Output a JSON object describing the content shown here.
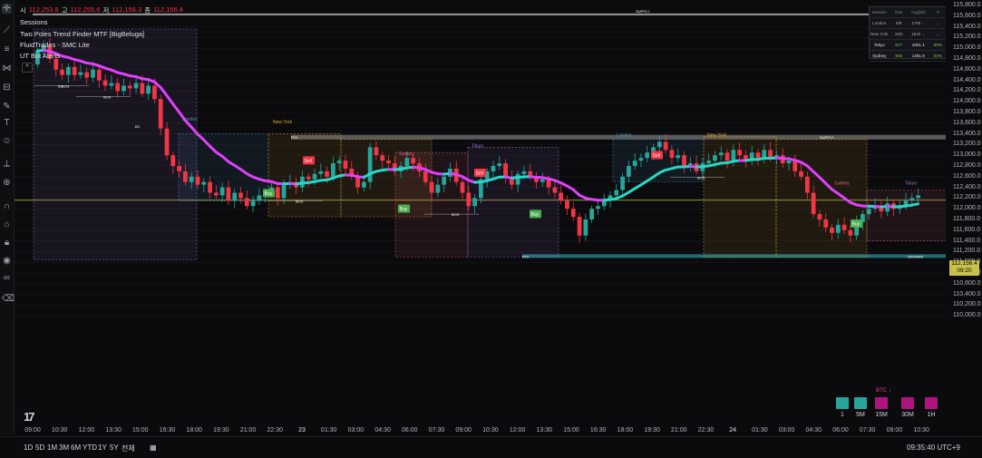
{
  "legend": {
    "ohlc": [
      {
        "k": "시",
        "v": "112,253.8"
      },
      {
        "k": "고",
        "v": "112,255.6"
      },
      {
        "k": "저",
        "v": "112,156.3"
      },
      {
        "k": "종",
        "v": "112,156.4"
      }
    ],
    "indicators": [
      "Sessions",
      "Two Poles Trend Finder MTF [BigBeluga]",
      "FluidTrades - SMC Lite",
      "UT Bot Alerts"
    ]
  },
  "session_table": {
    "header": [
      "Session",
      "Ove",
      "Avg(50)",
      "V"
    ],
    "rows": [
      [
        "London",
        "8/8",
        "1790 ...",
        "..."
      ],
      [
        "New York",
        "16/2",
        "1620 ...",
        "..."
      ],
      [
        "Tokyo",
        "577",
        "1801.1",
        "59%"
      ],
      [
        "Sydney",
        "945",
        "1481.8",
        "64%"
      ]
    ]
  },
  "price_axis": [
    "115,800.0",
    "115,600.0",
    "115,400.0",
    "115,200.0",
    "115,000.0",
    "114,800.0",
    "114,600.0",
    "114,400.0",
    "114,200.0",
    "114,000.0",
    "113,800.0",
    "113,600.0",
    "113,400.0",
    "113,200.0",
    "113,000.0",
    "112,800.0",
    "112,600.0",
    "112,400.0",
    "112,200.0",
    "112,000.0",
    "111,800.0",
    "111,600.0",
    "111,400.0",
    "111,200.0",
    "111,000.0",
    "110,800.0",
    "110,600.0",
    "110,400.0",
    "110,200.0",
    "110,000.0"
  ],
  "last_price": {
    "value": "112,156.4",
    "countdown": "09:20",
    "color": "#c8c24a"
  },
  "time_axis": [
    "09:00",
    "10:30",
    "12:00",
    "13:30",
    "15:00",
    "16:30",
    "18:00",
    "19:30",
    "21:00",
    "22:30",
    "23",
    "01:30",
    "03:00",
    "04:30",
    "06:00",
    "07:30",
    "09:00",
    "10:30",
    "12:00",
    "13:30",
    "15:00",
    "16:30",
    "18:00",
    "19:30",
    "21:00",
    "22:30",
    "24",
    "01:30",
    "03:00",
    "04:30",
    "06:00",
    "07:30",
    "09:00",
    "10:30"
  ],
  "ranges": [
    "1D",
    "5D",
    "1M",
    "3M",
    "6M",
    "YTD",
    "1Y",
    "5Y",
    "전체"
  ],
  "clock": "09:35:40 UTC+9",
  "timeframes": {
    "symbol": "BTC",
    "items": [
      {
        "label": "1",
        "color": "#26a69a"
      },
      {
        "label": "5M",
        "color": "#26a69a"
      },
      {
        "label": "15M",
        "color": "#b0127e"
      },
      {
        "label": "30M",
        "color": "#b0127e"
      },
      {
        "label": "1H",
        "color": "#b0127e"
      }
    ]
  },
  "chart_labels": {
    "supply": "SUPPLY",
    "demand": "DEMAND",
    "bos": "BOS",
    "poi": "POI",
    "bc": "BC",
    "london": "London",
    "new_york": "New York",
    "sydney": "Sydney",
    "tokyo": "Tokyo",
    "buy": "Buy",
    "sell": "Sell"
  },
  "colors": {
    "up": "#26a69a",
    "down": "#f23645",
    "trend_bear": "#e040fb",
    "trend_bull": "#26d7c8",
    "supply": "#8a8a8a",
    "demand": "#1f6f73",
    "london": "#4a90c2",
    "new_york": "#e0a030",
    "sydney": "#e06080",
    "tokyo": "#9a7ad0"
  }
}
